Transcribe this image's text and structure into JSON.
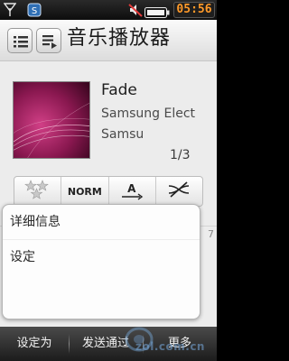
{
  "status_bar": {
    "time": "05:56",
    "icons": [
      "signal-strength-icon",
      "messenger-icon",
      "muted-speaker-icon",
      "battery-icon"
    ]
  },
  "header": {
    "title": "音乐播放器",
    "left_buttons": [
      "list-icon",
      "now-playing-list-icon"
    ]
  },
  "track": {
    "title": "Fade",
    "artist": "Samsung Elect",
    "album": "Samsu",
    "position": "1/3"
  },
  "controls": {
    "rating": "3-star-rating-icon",
    "eq_mode": "NORM",
    "repeat": "A",
    "shuffle": "shuffle-off-icon"
  },
  "progress_peek": {
    "time": "7"
  },
  "popup_menu": {
    "items": [
      "详细信息",
      "设定"
    ]
  },
  "softkeys": {
    "items": [
      "设定为",
      "发送通过",
      "更多"
    ]
  },
  "watermark": {
    "text": "zol.com.cn"
  },
  "colors": {
    "clock_text": "#ff9a2a",
    "accent_album": "#6b0f3c",
    "softkey_bg": "#2a2a2a"
  }
}
